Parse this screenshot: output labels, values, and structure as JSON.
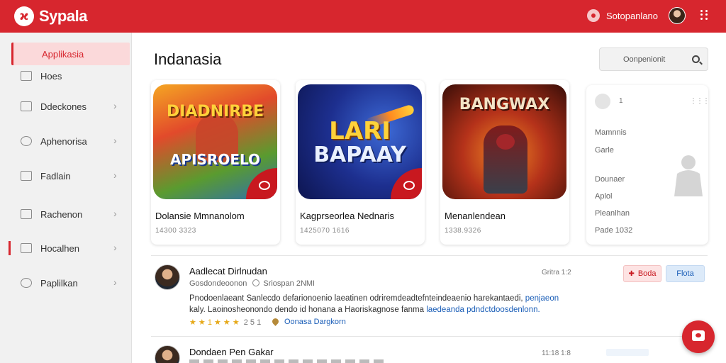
{
  "header": {
    "app_name": "Sypala",
    "user_name": "Sotopanlano"
  },
  "sidebar": {
    "active": {
      "label": "Applikasia"
    },
    "items": [
      {
        "label": "Hoes",
        "icon": "mail-icon"
      },
      {
        "label": "Ddeckones",
        "icon": "folder-icon"
      },
      {
        "label": "Aphenorisa",
        "icon": "compass-icon"
      },
      {
        "label": "Fadlain",
        "icon": "document-icon"
      },
      {
        "label": "Rachenon",
        "icon": "briefcase-icon"
      },
      {
        "label": "Hocalhen",
        "icon": "people-icon"
      },
      {
        "label": "Paplilkan",
        "icon": "info-icon"
      }
    ]
  },
  "main": {
    "title": "Indanasia",
    "search_placeholder": "Oonpenionit"
  },
  "cards": [
    {
      "art_top": "DIADNIRBE",
      "art_bottom": "APISROELO",
      "title": "Dolansie Mmnanolom",
      "meta": "14300 3323"
    },
    {
      "art_top": "LARI",
      "art_bottom": "BAPAAY",
      "title": "Kagprseorlea Nednaris",
      "meta": "1425070 1616"
    },
    {
      "art_top": "BANGWAX",
      "art_bottom": "",
      "title": "Menanlendean",
      "meta": "1338.9326"
    }
  ],
  "side_card": {
    "number": "1",
    "lines": [
      "Mamnnis",
      "Garle",
      "Dounaer",
      "Aplol",
      "Pleanlhan",
      "Pade 1032"
    ]
  },
  "posts": [
    {
      "name": "Aadlecat Dirlnudan",
      "subtitle": "Gosdondeoonon",
      "subtitle2": "Sriospan 2NMI",
      "time": "Gritra 1:2",
      "body_a": "Pnodoenlaeant Sanlecdo defarionoenio laeatinen odriremdeadtefnteindeaenio harekantaedi,",
      "body_hl1": "penjaeon",
      "body_b": "kaly. Laoinosheonondo dendo id honana a Haoriskagnose fanma",
      "body_hl2": "laedeanda pdndctdoosdenlonn.",
      "rating": "★ ★ 1 ★ ★ ★",
      "rating_count": "2 5 1",
      "link": "Oonasa Dargkorn",
      "btn_red": "Boda",
      "btn_blue": "Flota"
    },
    {
      "name": "Dondaen Pen Gakar",
      "time": "11:18 1:8"
    }
  ]
}
